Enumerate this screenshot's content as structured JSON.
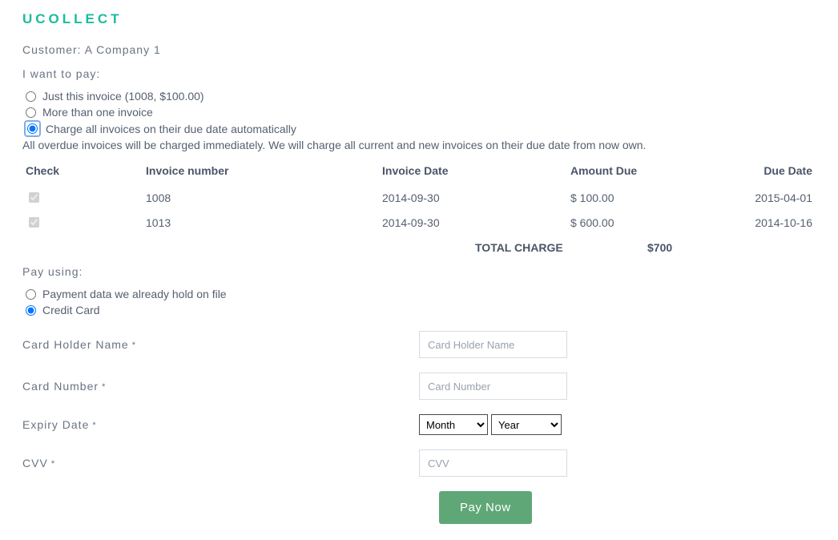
{
  "brand": "UCOLLECT",
  "customer_prefix": "Customer: ",
  "customer_name": "A Company 1",
  "i_want_to_pay": "I want to pay:",
  "pay_options": {
    "just_this": "Just this invoice (1008, $100.00)",
    "more_than_one": "More than one invoice",
    "charge_all": "Charge all invoices on their due date automatically"
  },
  "charge_all_note": "All overdue invoices will be charged immediately. We will charge all current and new invoices on their due date from now own.",
  "invoice_table": {
    "headers": {
      "check": "Check",
      "number": "Invoice number",
      "date": "Invoice Date",
      "amount": "Amount Due",
      "due": "Due Date"
    },
    "rows": [
      {
        "checked": true,
        "number": "1008",
        "date": "2014-09-30",
        "amount": "$ 100.00",
        "due": "2015-04-01"
      },
      {
        "checked": true,
        "number": "1013",
        "date": "2014-09-30",
        "amount": "$ 600.00",
        "due": "2014-10-16"
      }
    ],
    "total_label": "TOTAL CHARGE",
    "total_value": "$700"
  },
  "pay_using": "Pay using:",
  "pay_methods": {
    "on_file": "Payment data we already hold on file",
    "credit_card": "Credit Card"
  },
  "cc_form": {
    "holder_label": "Card Holder Name",
    "holder_placeholder": "Card Holder Name",
    "number_label": "Card Number",
    "number_placeholder": "Card Number",
    "expiry_label": "Expiry Date",
    "month_placeholder": "Month",
    "year_placeholder": "Year",
    "cvv_label": "CVV",
    "cvv_placeholder": "CVV"
  },
  "pay_now": "Pay Now"
}
